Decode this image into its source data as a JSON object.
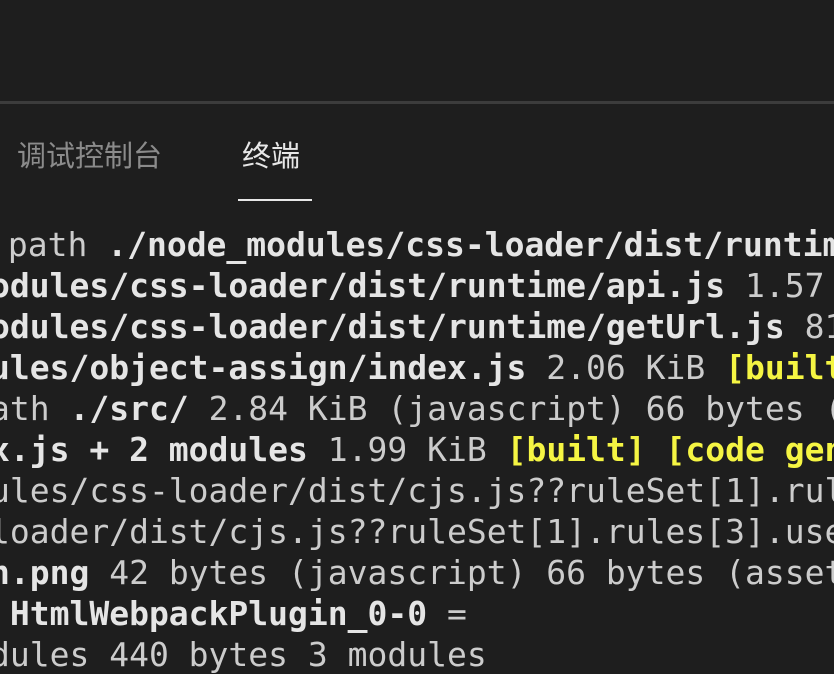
{
  "panel": {
    "tabs": [
      {
        "label": "调试控制台",
        "active": false
      },
      {
        "label": "终端",
        "active": true
      }
    ]
  },
  "terminal": {
    "lines": [
      {
        "parts": [
          {
            "text": " path ",
            "style": "normal"
          },
          {
            "text": "./node_modules/css-loader/dist/runtim",
            "style": "bold"
          }
        ]
      },
      {
        "parts": [
          {
            "text": "odules/css-loader/dist/runtime/api.js",
            "style": "bold"
          },
          {
            "text": " 1.57",
            "style": "normal"
          }
        ]
      },
      {
        "parts": [
          {
            "text": "odules/css-loader/dist/runtime/getUrl.js",
            "style": "bold"
          },
          {
            "text": " 81",
            "style": "normal"
          }
        ]
      },
      {
        "parts": [
          {
            "text": "ules/object-assign/index.js",
            "style": "bold"
          },
          {
            "text": " 2.06 KiB ",
            "style": "normal"
          },
          {
            "text": "[built",
            "style": "yellow"
          }
        ]
      },
      {
        "parts": [
          {
            "text": "ath ",
            "style": "normal"
          },
          {
            "text": "./src/",
            "style": "bold"
          },
          {
            "text": " 2.84 KiB (javascript) 66 bytes (",
            "style": "normal"
          }
        ]
      },
      {
        "parts": [
          {
            "text": "x.js + 2 modules",
            "style": "bold"
          },
          {
            "text": " 1.99 KiB ",
            "style": "normal"
          },
          {
            "text": "[built] [code gen",
            "style": "yellow"
          }
        ]
      },
      {
        "parts": [
          {
            "text": "ules/css-loader/dist/cjs.js??ruleSet[1].rul",
            "style": "normal"
          }
        ]
      },
      {
        "parts": [
          {
            "text": "loader/dist/cjs.js??ruleSet[1].rules[3].use",
            "style": "normal"
          }
        ]
      },
      {
        "parts": [
          {
            "text": "n.png",
            "style": "bold"
          },
          {
            "text": " 42 bytes (javascript) 66 bytes (asset",
            "style": "normal"
          }
        ]
      },
      {
        "parts": [
          {
            "text": " HtmlWebpackPlugin_0-0",
            "style": "bold"
          },
          {
            "text": " =",
            "style": "normal"
          }
        ]
      },
      {
        "parts": [
          {
            "text": "dules 440 bytes 3 modules",
            "style": "normal"
          }
        ]
      }
    ]
  }
}
